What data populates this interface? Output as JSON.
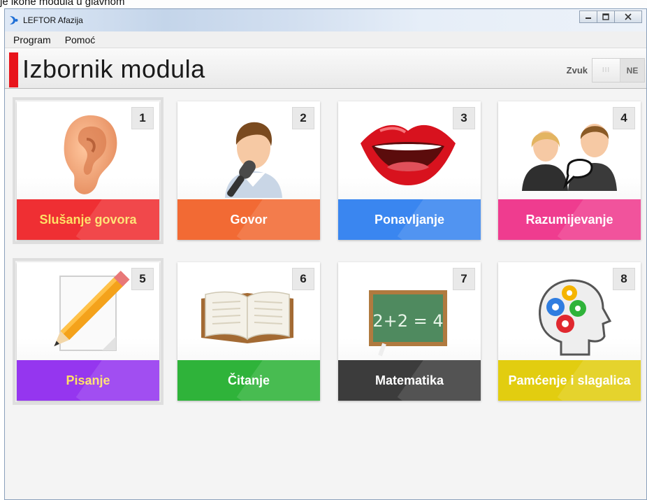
{
  "window": {
    "title": "LEFTOR Afazija",
    "top_strip_text": "je ikone modula u glavnom"
  },
  "menu": {
    "items": [
      "Program",
      "Pomoć"
    ]
  },
  "header": {
    "title": "Izbornik modula",
    "sound_label": "Zvuk",
    "sound_grip": "III",
    "sound_state": "NE"
  },
  "colors": {
    "accent": "#e8141b",
    "slusanje": "#ef2f33",
    "govor": "#f26a34",
    "ponavljanje": "#3a86f0",
    "razumijevanje": "#ef3c8f",
    "pisanje": "#9536ef",
    "citanje": "#2fb33a",
    "matematika": "#3c3c3c",
    "pamcenje": "#e2cd10"
  },
  "modules": [
    {
      "number": "1",
      "label": "Slušanje govora",
      "icon": "ear-icon",
      "color": "#ef2f33",
      "label_color": "#ffe066",
      "selected": true
    },
    {
      "number": "2",
      "label": "Govor",
      "icon": "speaker-microphone-icon",
      "color": "#f26a34",
      "label_color": "#ffffff",
      "selected": false
    },
    {
      "number": "3",
      "label": "Ponavljanje",
      "icon": "lips-icon",
      "color": "#3a86f0",
      "label_color": "#ffffff",
      "selected": false
    },
    {
      "number": "4",
      "label": "Razumijevanje",
      "icon": "conversation-people-icon",
      "color": "#ef3c8f",
      "label_color": "#ffffff",
      "selected": false
    },
    {
      "number": "5",
      "label": "Pisanje",
      "icon": "pencil-paper-icon",
      "color": "#9536ef",
      "label_color": "#ffe066",
      "selected": true
    },
    {
      "number": "6",
      "label": "Čitanje",
      "icon": "open-book-icon",
      "color": "#2fb33a",
      "label_color": "#ffffff",
      "selected": false
    },
    {
      "number": "7",
      "label": "Matematika",
      "icon": "chalkboard-icon",
      "color": "#3c3c3c",
      "label_color": "#ffffff",
      "selected": false
    },
    {
      "number": "8",
      "label": "Pamćenje i slagalica",
      "icon": "brain-gears-icon",
      "color": "#e2cd10",
      "label_color": "#ffffff",
      "selected": false
    }
  ],
  "chalkboard_text": "2+2 = 4"
}
